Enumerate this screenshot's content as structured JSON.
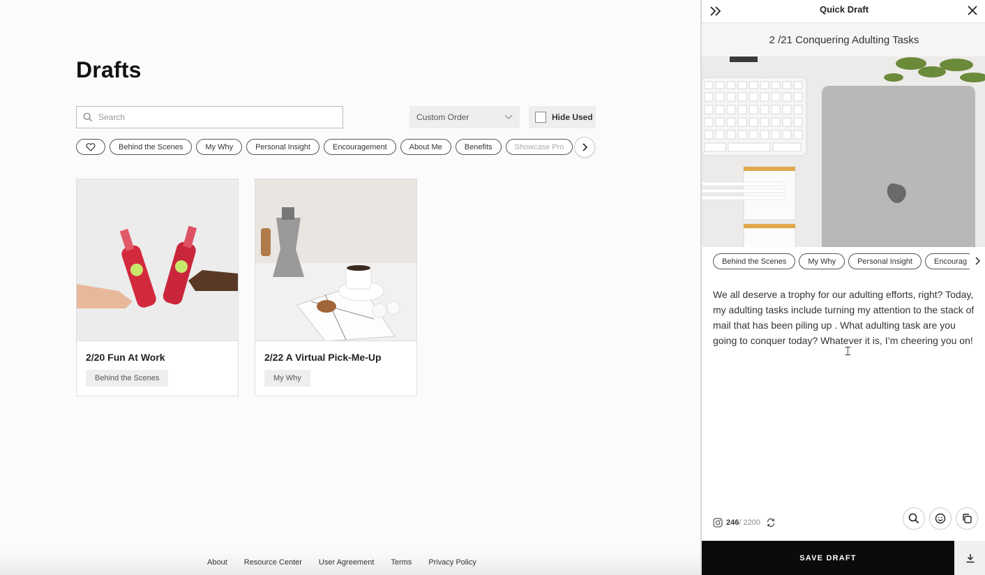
{
  "page": {
    "title": "Drafts"
  },
  "filters": {
    "search_placeholder": "Search",
    "order_label": "Custom Order",
    "hide_used_label": "Hide Used"
  },
  "tags": [
    "Behind the Scenes",
    "My Why",
    "Personal Insight",
    "Encouragement",
    "About Me",
    "Benefits",
    "Showcase Pro"
  ],
  "cards": [
    {
      "title": "2/20 Fun At Work",
      "tag": "Behind the Scenes"
    },
    {
      "title": "2/22 A Virtual Pick-Me-Up",
      "tag": "My Why"
    }
  ],
  "footer": {
    "links": [
      "About",
      "Resource Center",
      "User Agreement",
      "Terms",
      "Privacy Policy"
    ]
  },
  "panel": {
    "title": "Quick Draft",
    "draft_title": "2 /21 Conquering Adulting Tasks",
    "tags": [
      "Behind the Scenes",
      "My Why",
      "Personal Insight",
      "Encourag"
    ],
    "body": "We all deserve a trophy for our adulting efforts, right? Today, my adulting tasks include turning my attention to the stack of mail that has been piling up . What adulting task are you going to conquer today? Whatever it is, I’m cheering you on!",
    "char_count": "246",
    "char_max": "/ 2200",
    "save_label": "SAVE DRAFT"
  },
  "colors": {
    "save_bar": "#0b0b0b",
    "chip_border": "#555555"
  }
}
